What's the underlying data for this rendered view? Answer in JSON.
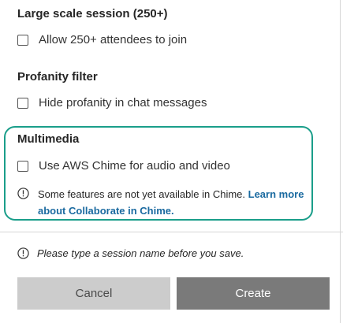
{
  "large_scale": {
    "title": "Large scale session (250+)",
    "checkbox_label": "Allow 250+ attendees to join",
    "checked": false
  },
  "profanity": {
    "title": "Profanity filter",
    "checkbox_label": "Hide profanity in chat messages",
    "checked": false
  },
  "multimedia": {
    "title": "Multimedia",
    "checkbox_label": "Use AWS Chime for audio and video",
    "checked": false,
    "info_text": "Some features are not yet available in Chime. ",
    "info_link": "Learn more about Collaborate in Chime."
  },
  "footer": {
    "warning": "Please type a session name before you save.",
    "cancel_label": "Cancel",
    "create_label": "Create"
  },
  "colors": {
    "highlight_border": "#1a9e8a",
    "link": "#1a6aa0",
    "cancel_bg": "#cccccc",
    "create_bg": "#7a7a7a"
  },
  "icons": {
    "info": "info-circle-icon",
    "warning": "info-circle-icon"
  }
}
